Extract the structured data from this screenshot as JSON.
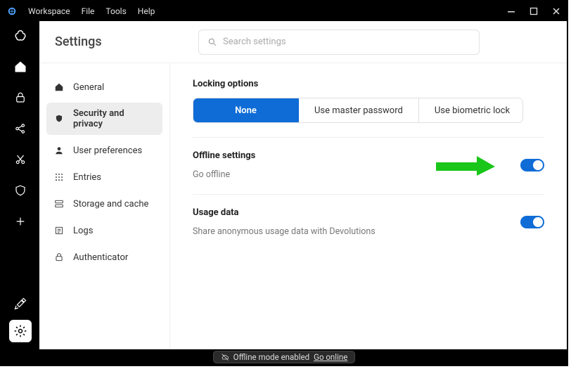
{
  "titlebar": {
    "app_name": "Workspace",
    "menus": [
      "File",
      "Tools",
      "Help"
    ]
  },
  "page": {
    "title": "Settings",
    "search_placeholder": "Search settings"
  },
  "side_menu": {
    "items": [
      {
        "icon": "home-icon",
        "label": "General"
      },
      {
        "icon": "shield-icon",
        "label": "Security and privacy",
        "active": true
      },
      {
        "icon": "user-icon",
        "label": "User preferences"
      },
      {
        "icon": "grid-icon",
        "label": "Entries"
      },
      {
        "icon": "storage-icon",
        "label": "Storage and cache"
      },
      {
        "icon": "logs-icon",
        "label": "Logs"
      },
      {
        "icon": "lock-icon",
        "label": "Authenticator"
      }
    ]
  },
  "sections": {
    "locking": {
      "title": "Locking options",
      "options": [
        "None",
        "Use master password",
        "Use biometric lock"
      ],
      "selected": "None"
    },
    "offline": {
      "title": "Offline settings",
      "subtitle": "Go offline",
      "toggle": true
    },
    "usage": {
      "title": "Usage data",
      "subtitle": "Share anonymous usage data with Devolutions",
      "toggle": true
    }
  },
  "status": {
    "text": "Offline mode enabled",
    "link": "Go online"
  },
  "callout": {
    "arrow_color": "#19c619"
  },
  "colors": {
    "accent": "#0f6cd6"
  }
}
